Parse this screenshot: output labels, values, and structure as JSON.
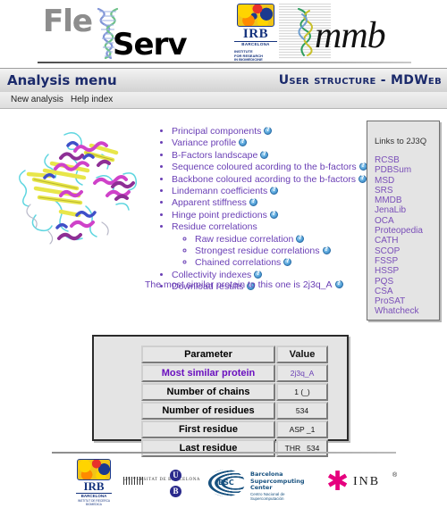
{
  "banner": {
    "flex_text": "Fle",
    "serv_text": "Serv",
    "helix_icon": "protein-helix-icon",
    "irb_name": "IRB",
    "irb_sub": "BARCELONA",
    "irb_tagline": "INSTITUTE\nFOR RESEARCH\nIN BIOMEDICINE",
    "mmb_text": "mmb"
  },
  "titlebar": {
    "left": "Analysis menu",
    "right": "User structure - MDWeb"
  },
  "menubar": {
    "items": [
      {
        "label": "New analysis"
      },
      {
        "label": "Help index"
      }
    ]
  },
  "main": {
    "protein_image_alt": "protein-cartoon-structure",
    "analyses": [
      {
        "label": "Principal components",
        "help": true
      },
      {
        "label": "Variance profile",
        "help": true
      },
      {
        "label": "B-Factors landscape",
        "help": true
      },
      {
        "label": "Sequence coloured acording to the b-factors",
        "help": true
      },
      {
        "label": "Backbone coloured acording to the b-factors",
        "help": true
      },
      {
        "label": "Lindemann coefficients",
        "help": true
      },
      {
        "label": "Apparent stiffness",
        "help": true
      },
      {
        "label": "Hinge point predictions",
        "help": true
      },
      {
        "label": "Residue correlations",
        "help": false,
        "children": [
          {
            "label": "Raw residue correlation",
            "help": true
          },
          {
            "label": "Strongest residue correlations",
            "help": true
          },
          {
            "label": "Chained correlations",
            "help": true
          }
        ]
      },
      {
        "label": "Collectivity indexes",
        "help": true
      },
      {
        "label": "Download results",
        "help": true
      }
    ],
    "similar_prefix": "The most similar protein to this one is ",
    "similar_value": "2j3q_A"
  },
  "sidebox": {
    "title": "Links to 2J3Q",
    "links": [
      "RCSB",
      "PDBSum",
      "MSD",
      "SRS",
      "MMDB",
      "JenaLib",
      "OCA",
      "Proteopedia",
      "CATH",
      "SCOP",
      "FSSP",
      "HSSP",
      "PQS",
      "CSA",
      "ProSAT",
      "Whatcheck"
    ]
  },
  "table": {
    "headers": {
      "parameter": "Parameter",
      "value": "Value"
    },
    "rows": [
      {
        "parameter": "Most similar protein",
        "value": "2j3q_A",
        "param_link": true,
        "value_link": true
      },
      {
        "parameter": "Number of chains",
        "value": "1 (_)",
        "param_link": false,
        "value_link": false
      },
      {
        "parameter": "Number of residues",
        "value": "534",
        "param_link": false,
        "value_link": false
      },
      {
        "parameter": "First residue",
        "value": "ASP _1",
        "param_link": false,
        "value_link": false
      },
      {
        "parameter": "Last residue",
        "value": "THR _534",
        "param_link": false,
        "value_link": false
      }
    ]
  },
  "footer": {
    "irb_name": "IRB",
    "irb_sub": "BARCELONA",
    "irb_tagline": "INSTITUT DE RECERCA BIOMEDICA",
    "ub_text": "UNIVERSITAT DE BARCELONA",
    "ub_u": "U",
    "ub_b": "B",
    "bsc_mark": "BSC",
    "bsc_line1": "Barcelona",
    "bsc_line2": "Supercomputing",
    "bsc_line3": "Center",
    "bsc_sub": "Centro Nacional de Supercomputación",
    "inb_text": "INB",
    "inb_deg": "®"
  },
  "colors": {
    "link_purple": "#6a3fb5",
    "title_navy": "#1b2a6b",
    "panel_grey": "#e4e4e4",
    "irb_blue": "#15337e",
    "bsc_blue": "#17517f",
    "inb_pink": "#e6007e"
  }
}
